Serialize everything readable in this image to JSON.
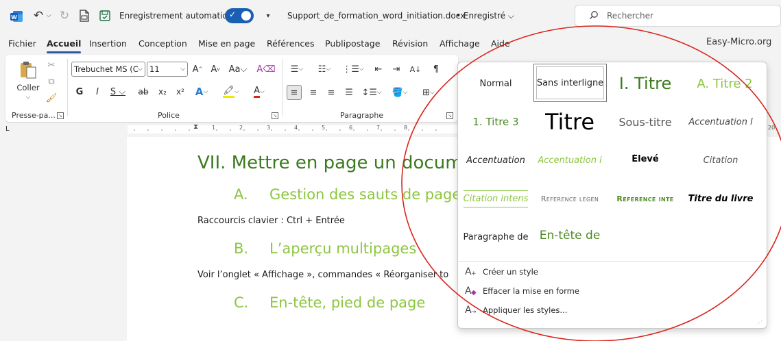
{
  "titlebar": {
    "autosave_label": "Enregistrement automatique",
    "doc_name": "Support_de_formation_word_initiation.docx",
    "doc_status": "• Enregistré ⌵",
    "search_placeholder": "Rechercher"
  },
  "tabs": [
    {
      "label": "Fichier",
      "active": false
    },
    {
      "label": "Accueil",
      "active": true
    },
    {
      "label": "Insertion",
      "active": false
    },
    {
      "label": "Conception",
      "active": false
    },
    {
      "label": "Mise en page",
      "active": false
    },
    {
      "label": "Références",
      "active": false
    },
    {
      "label": "Publipostage",
      "active": false
    },
    {
      "label": "Révision",
      "active": false
    },
    {
      "label": "Affichage",
      "active": false
    },
    {
      "label": "Aide",
      "active": false
    }
  ],
  "site_label": "Easy-Micro.org",
  "ribbon": {
    "clipboard": {
      "paste_label": "Coller",
      "group_label": "Presse-pa..."
    },
    "font": {
      "font_name": "Trebuchet MS (C",
      "font_size": "11",
      "group_label": "Police"
    },
    "paragraph": {
      "group_label": "Paragraphe"
    }
  },
  "ruler": {
    "numbers": [
      "1",
      "2",
      "3",
      "4",
      "5",
      "6",
      "7",
      "8",
      "20"
    ]
  },
  "document": {
    "heading1": "VII. Mettre en page un docum",
    "sections": [
      {
        "num": "A.",
        "title": "Gestion des sauts de page",
        "body": "Raccourcis clavier : Ctrl + Entrée"
      },
      {
        "num": "B.",
        "title": "L’aperçu multipages",
        "body": "Voir l’onglet « Affichage », commandes « Réorganiser to"
      },
      {
        "num": "C.",
        "title": "En-tête, pied de page",
        "body": ""
      }
    ]
  },
  "styles_gallery": {
    "styles": [
      {
        "label": "Normal"
      },
      {
        "label": "Sans interligne"
      },
      {
        "label": "I.  Titre"
      },
      {
        "label": "A.  Titre 2"
      },
      {
        "label": "1.  Titre 3"
      },
      {
        "label": "Titre"
      },
      {
        "label": "Sous-titre"
      },
      {
        "label": "Accentuation l"
      },
      {
        "label": "Accentuation"
      },
      {
        "label": "Accentuation i"
      },
      {
        "label": "Élevé"
      },
      {
        "label": "Citation"
      },
      {
        "label": "Citation intens"
      },
      {
        "label": "Reference legen"
      },
      {
        "label": "Reference inte"
      },
      {
        "label": "Titre du livre"
      },
      {
        "label": "Paragraphe de"
      },
      {
        "label": "En-tête de"
      }
    ],
    "selected_style": "Sans interligne",
    "commands": [
      {
        "label": "Créer un style",
        "icon": "create-style-icon"
      },
      {
        "label": "Effacer la mise en forme",
        "icon": "clear-formatting-icon"
      },
      {
        "label": "Appliquer les styles...",
        "icon": "apply-styles-icon"
      }
    ]
  },
  "colors": {
    "heading_dark_green": "#3b7a1e",
    "heading_light_green": "#8cc63f",
    "accent_blue": "#2b579a",
    "annotation_red": "#d9251c"
  }
}
